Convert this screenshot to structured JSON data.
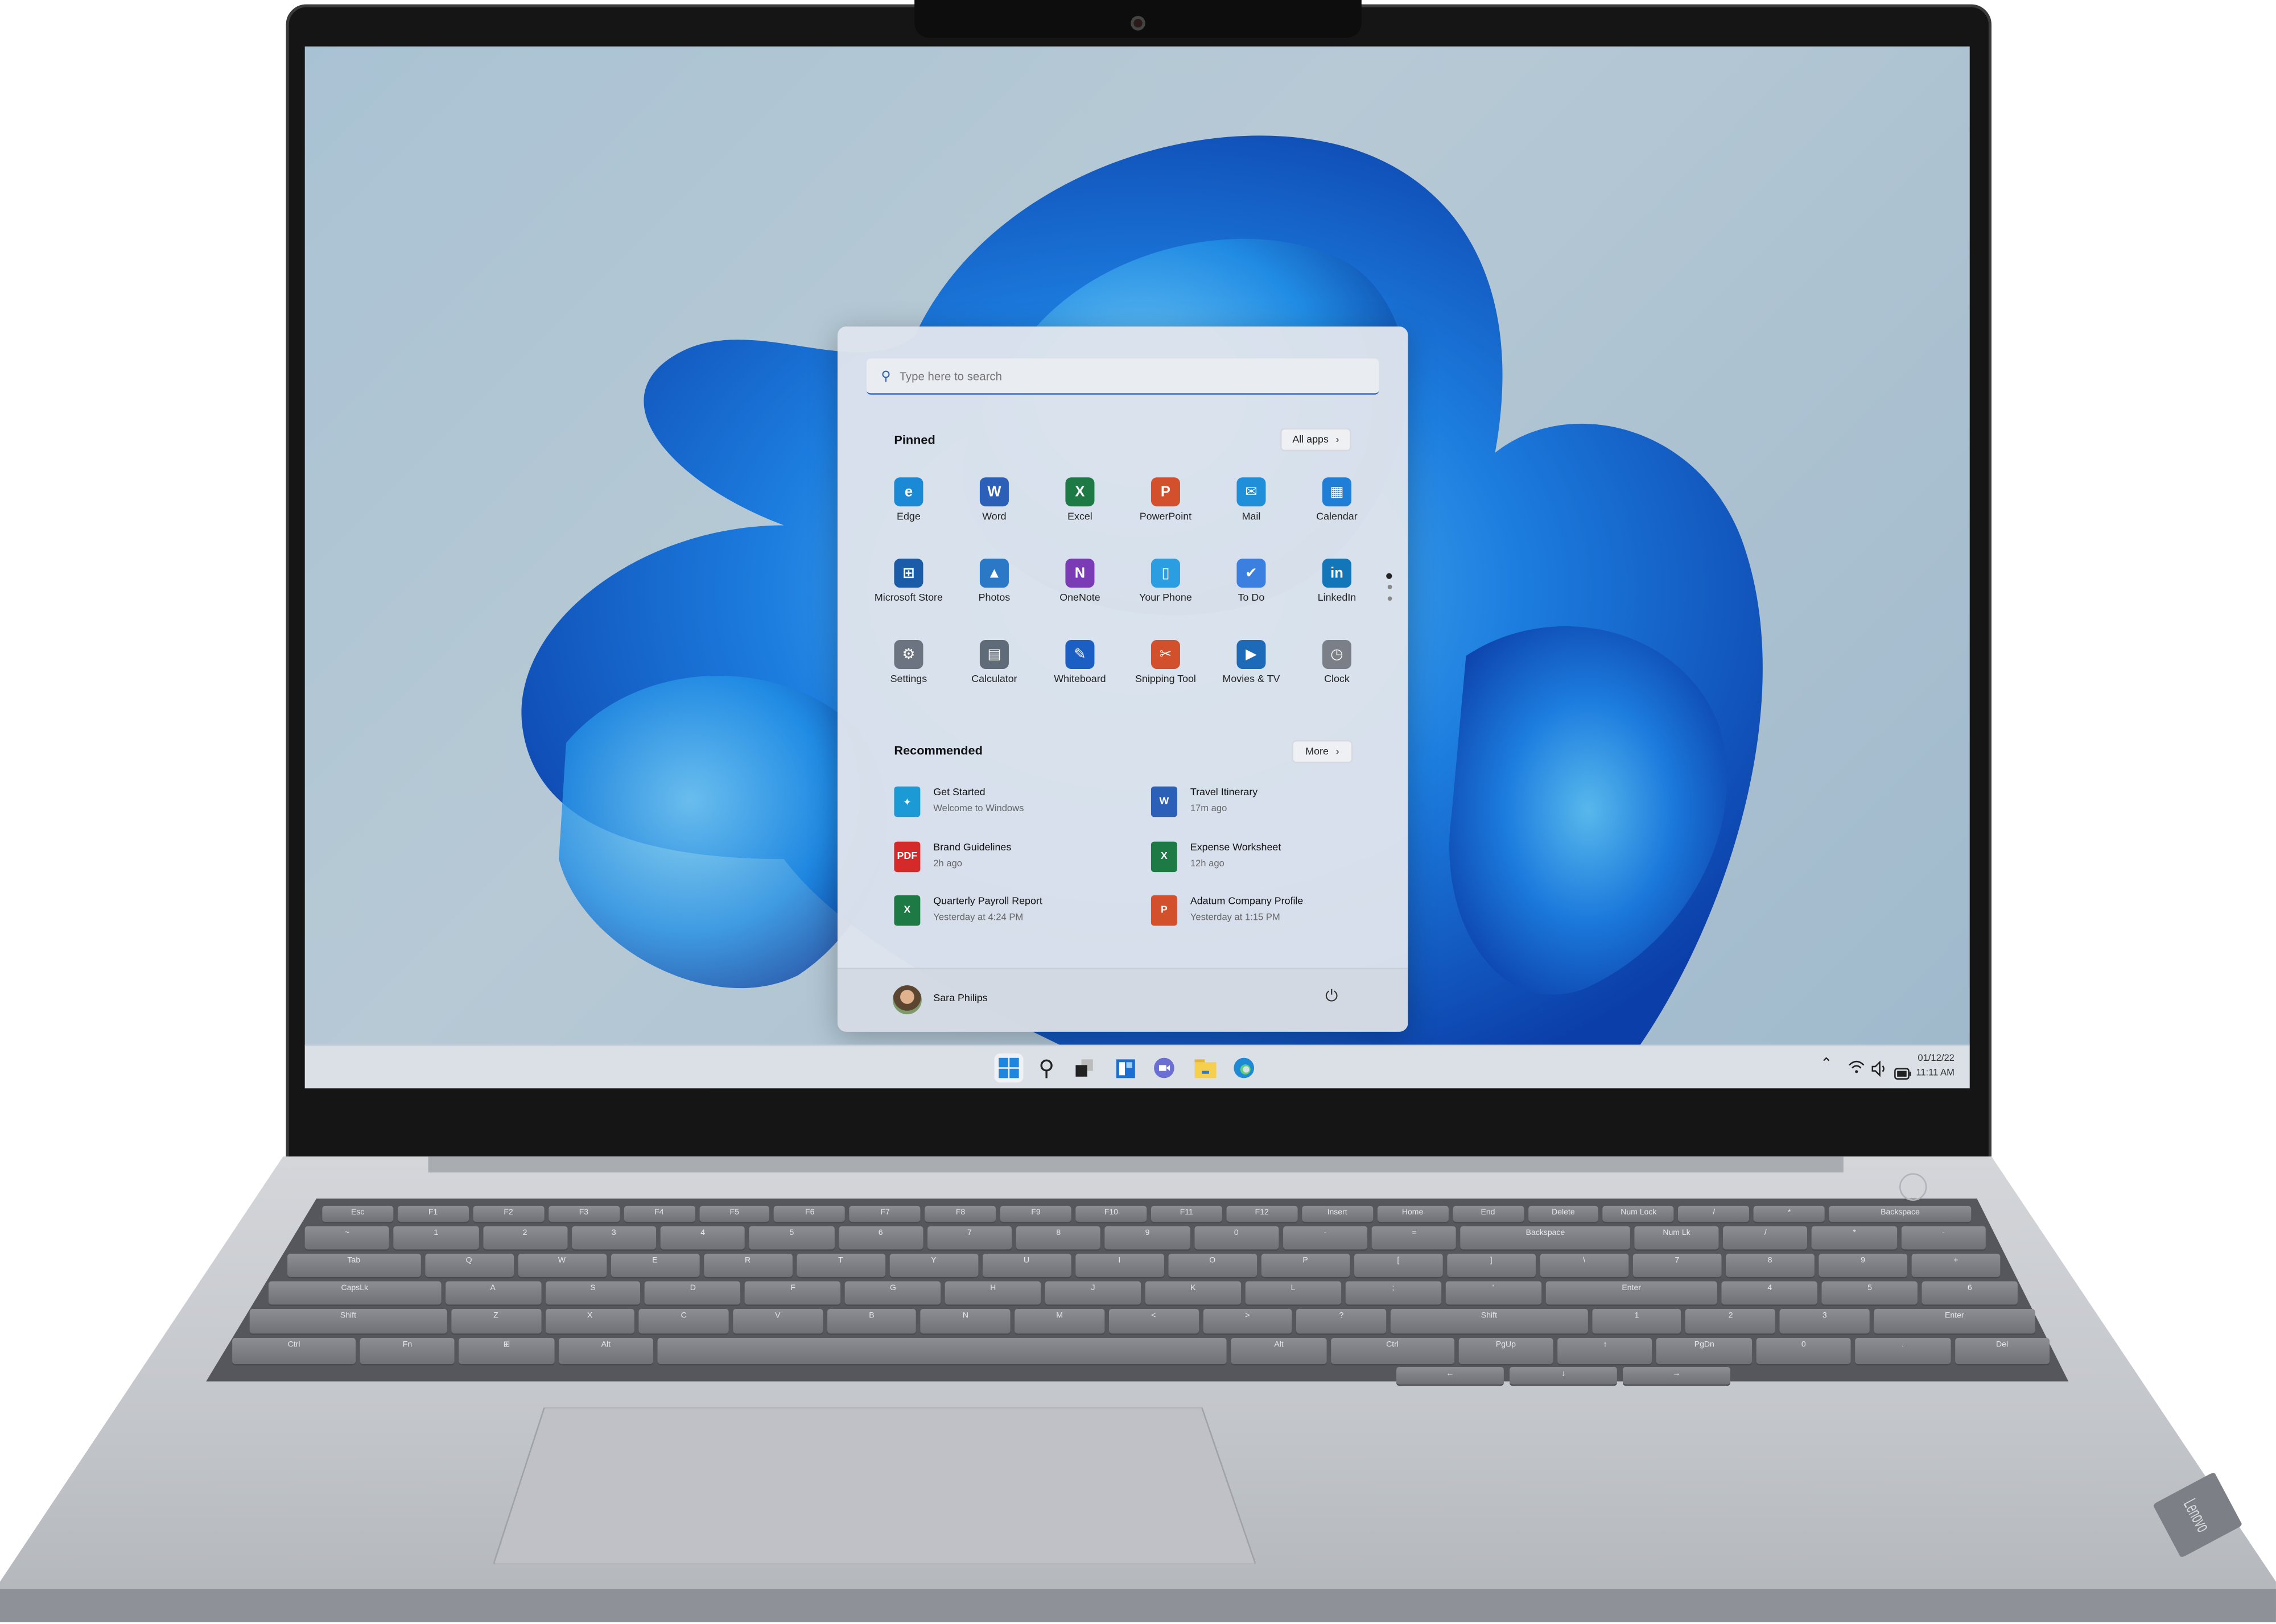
{
  "device": {
    "brand_logo": "Lenovo"
  },
  "search": {
    "placeholder": "Type here to search"
  },
  "pinned": {
    "title": "Pinned",
    "all_apps_label": "All apps",
    "apps": [
      {
        "label": "Edge",
        "icon": "edge-icon",
        "color": "#1b8ad6",
        "glyph": "e"
      },
      {
        "label": "Word",
        "icon": "word-icon",
        "color": "#2b5fb8",
        "glyph": "W"
      },
      {
        "label": "Excel",
        "icon": "excel-icon",
        "color": "#1d7a45",
        "glyph": "X"
      },
      {
        "label": "PowerPoint",
        "icon": "powerpoint-icon",
        "color": "#d2502c",
        "glyph": "P"
      },
      {
        "label": "Mail",
        "icon": "mail-icon",
        "color": "#1e8fd8",
        "glyph": "✉"
      },
      {
        "label": "Calendar",
        "icon": "calendar-icon",
        "color": "#1f7fd6",
        "glyph": "▦"
      },
      {
        "label": "Microsoft Store",
        "icon": "store-icon",
        "color": "#1a5ca8",
        "glyph": "⊞"
      },
      {
        "label": "Photos",
        "icon": "photos-icon",
        "color": "#2a78c6",
        "glyph": "▲"
      },
      {
        "label": "OneNote",
        "icon": "onenote-icon",
        "color": "#7b3bb5",
        "glyph": "N"
      },
      {
        "label": "Your Phone",
        "icon": "phone-icon",
        "color": "#2a9ee0",
        "glyph": "▯"
      },
      {
        "label": "To Do",
        "icon": "todo-icon",
        "color": "#3b7fe0",
        "glyph": "✔"
      },
      {
        "label": "LinkedIn",
        "icon": "linkedin-icon",
        "color": "#1276b9",
        "glyph": "in"
      },
      {
        "label": "Settings",
        "icon": "gear-icon",
        "color": "#6b7480",
        "glyph": "⚙"
      },
      {
        "label": "Calculator",
        "icon": "calculator-icon",
        "color": "#5f6b78",
        "glyph": "▤"
      },
      {
        "label": "Whiteboard",
        "icon": "whiteboard-icon",
        "color": "#1b5fc4",
        "glyph": "✎"
      },
      {
        "label": "Snipping Tool",
        "icon": "scissors-icon",
        "color": "#d2502c",
        "glyph": "✂"
      },
      {
        "label": "Movies & TV",
        "icon": "movies-icon",
        "color": "#1d6ab8",
        "glyph": "▶"
      },
      {
        "label": "Clock",
        "icon": "clock-icon",
        "color": "#7b8088",
        "glyph": "◷"
      }
    ]
  },
  "recommended": {
    "title": "Recommended",
    "more_label": "More",
    "items": [
      {
        "name": "Get Started",
        "meta": "Welcome to Windows",
        "icon": "get-started-icon",
        "color": "#1c9ad6",
        "glyph": "✦"
      },
      {
        "name": "Travel Itinerary",
        "meta": "17m ago",
        "icon": "word-doc-icon",
        "color": "#2b5fb8",
        "glyph": "W"
      },
      {
        "name": "Brand Guidelines",
        "meta": "2h ago",
        "icon": "pdf-icon",
        "color": "#d42a2a",
        "glyph": "PDF"
      },
      {
        "name": "Expense Worksheet",
        "meta": "12h ago",
        "icon": "excel-doc-icon",
        "color": "#1d7a45",
        "glyph": "X"
      },
      {
        "name": "Quarterly Payroll Report",
        "meta": "Yesterday at 4:24 PM",
        "icon": "excel-doc-icon",
        "color": "#1d7a45",
        "glyph": "X"
      },
      {
        "name": "Adatum Company Profile",
        "meta": "Yesterday at 1:15 PM",
        "icon": "powerpoint-doc-icon",
        "color": "#d2502c",
        "glyph": "P"
      }
    ]
  },
  "user": {
    "name": "Sara Philips"
  },
  "taskbar": {
    "icons": [
      "start-icon",
      "search-icon",
      "task-view-icon",
      "widgets-icon",
      "teams-chat-icon",
      "file-explorer-icon",
      "edge-icon"
    ]
  },
  "tray": {
    "date": "01/12/22",
    "time": "11:11 AM"
  },
  "keyboard": {
    "rows": [
      [
        "Esc",
        "F1",
        "F2",
        "F3",
        "F4",
        "F5",
        "F6",
        "F7",
        "F8",
        "F9",
        "F10",
        "F11",
        "F12",
        "Insert",
        "Home",
        "End",
        "Delete",
        "Num Lock",
        "/",
        "*",
        "Backspace"
      ],
      [
        "~",
        "1",
        "2",
        "3",
        "4",
        "5",
        "6",
        "7",
        "8",
        "9",
        "0",
        "-",
        "=",
        "Backspace",
        "Num Lk",
        "/",
        "*",
        "-"
      ],
      [
        "Tab",
        "Q",
        "W",
        "E",
        "R",
        "T",
        "Y",
        "U",
        "I",
        "O",
        "P",
        "[",
        "]",
        "\\",
        "7",
        "8",
        "9",
        "+"
      ],
      [
        "CapsLk",
        "A",
        "S",
        "D",
        "F",
        "G",
        "H",
        "J",
        "K",
        "L",
        ";",
        "'",
        "Enter",
        "4",
        "5",
        "6"
      ],
      [
        "Shift",
        "Z",
        "X",
        "C",
        "V",
        "B",
        "N",
        "M",
        "<",
        ">",
        "?",
        "Shift",
        "1",
        "2",
        "3",
        "Enter"
      ],
      [
        "Ctrl",
        "Fn",
        "⊞",
        "Alt",
        "",
        "Alt",
        "Ctrl",
        "PgUp",
        "↑",
        "PgDn",
        "0",
        ".",
        "Del"
      ]
    ],
    "arrows": [
      "←",
      "↓",
      "→"
    ]
  }
}
